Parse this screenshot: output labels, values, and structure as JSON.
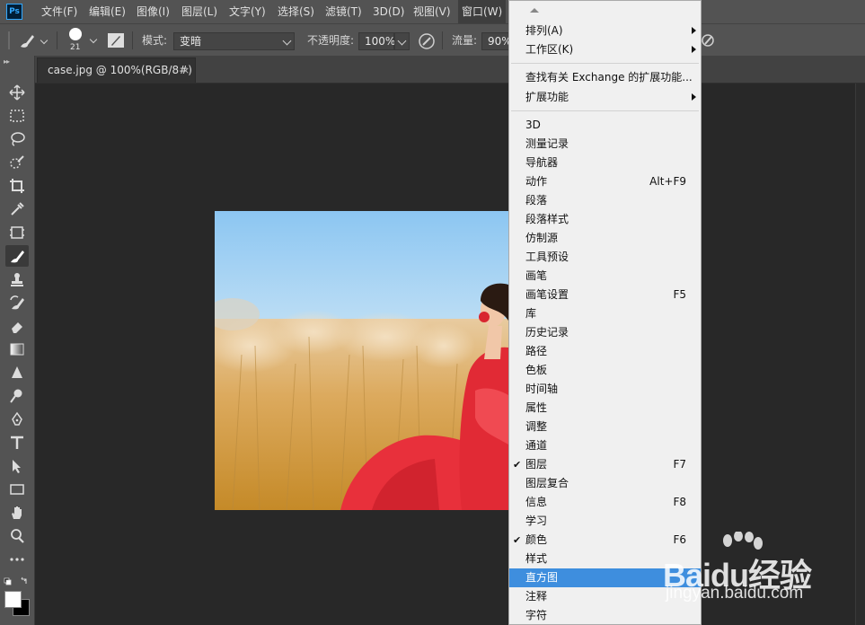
{
  "app": {
    "logo": "Ps"
  },
  "menubar": {
    "items": [
      "文件(F)",
      "编辑(E)",
      "图像(I)",
      "图层(L)",
      "文字(Y)",
      "选择(S)",
      "滤镜(T)",
      "3D(D)",
      "视图(V)",
      "窗口(W)"
    ],
    "active_index": 9
  },
  "options": {
    "brush_size": "21",
    "mode_label": "模式:",
    "mode_value": "变暗",
    "opacity_label": "不透明度:",
    "opacity_value": "100%",
    "flow_label": "流量:",
    "flow_value": "90%"
  },
  "document": {
    "tab_title": "case.jpg @ 100%(RGB/8#)",
    "close_glyph": "×"
  },
  "window_menu": {
    "items": [
      {
        "label": "排列(A)",
        "submenu": true
      },
      {
        "label": "工作区(K)",
        "submenu": true
      },
      {
        "label": "查找有关 Exchange 的扩展功能..."
      },
      {
        "label": "扩展功能",
        "submenu": true
      },
      {
        "label": "3D"
      },
      {
        "label": "测量记录"
      },
      {
        "label": "导航器"
      },
      {
        "label": "动作",
        "shortcut": "Alt+F9"
      },
      {
        "label": "段落"
      },
      {
        "label": "段落样式"
      },
      {
        "label": "仿制源"
      },
      {
        "label": "工具预设"
      },
      {
        "label": "画笔"
      },
      {
        "label": "画笔设置",
        "shortcut": "F5"
      },
      {
        "label": "库"
      },
      {
        "label": "历史记录"
      },
      {
        "label": "路径"
      },
      {
        "label": "色板"
      },
      {
        "label": "时间轴"
      },
      {
        "label": "属性"
      },
      {
        "label": "调整"
      },
      {
        "label": "通道"
      },
      {
        "label": "图层",
        "shortcut": "F7",
        "checked": true
      },
      {
        "label": "图层复合"
      },
      {
        "label": "信息",
        "shortcut": "F8"
      },
      {
        "label": "学习"
      },
      {
        "label": "颜色",
        "shortcut": "F6",
        "checked": true
      },
      {
        "label": "样式"
      },
      {
        "label": "直方图",
        "highlighted": true
      },
      {
        "label": "注释"
      },
      {
        "label": "字符"
      }
    ],
    "check_glyph": "✔"
  },
  "watermark": {
    "line1": "Baidu经验",
    "line2": "jingyan.baidu.com"
  },
  "colors": {
    "menu_highlight": "#3e8ede",
    "ui_panel": "#535353",
    "canvas": "#282828"
  }
}
